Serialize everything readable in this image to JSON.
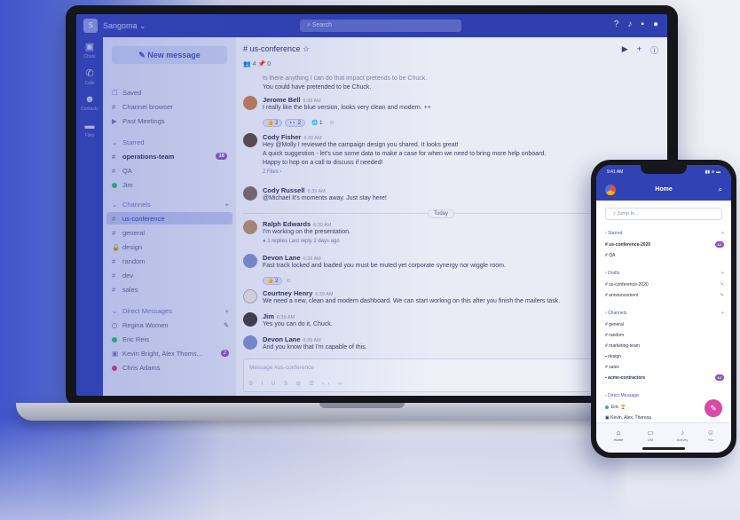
{
  "desktop": {
    "org_name": "Sangoma ⌄",
    "org_logo": "S",
    "search_placeholder": "Search",
    "rail": [
      {
        "label": "Chats",
        "icon": "chat-icon"
      },
      {
        "label": "Calls",
        "icon": "phone-icon"
      },
      {
        "label": "Contacts",
        "icon": "contacts-icon"
      },
      {
        "label": "Files",
        "icon": "folder-icon"
      }
    ],
    "sidebar": {
      "new_message": "New message",
      "top_items": [
        "Saved",
        "Channel browser",
        "Past Meetings"
      ],
      "starred_header": "Starred",
      "starred": [
        {
          "label": "operations-team",
          "badge": "16"
        },
        {
          "label": "QA",
          "badge": ""
        },
        {
          "label": "Jim",
          "badge": ""
        }
      ],
      "channels_header": "Channels",
      "channels": [
        "us-conference",
        "general",
        "design",
        "random",
        "dev",
        "sales"
      ],
      "dm_header": "Direct Messages",
      "dms": [
        {
          "label": "Regina Women",
          "badge": ""
        },
        {
          "label": "Eric Reis",
          "badge": ""
        },
        {
          "label": "Kevin Bright, Alex Thoms...",
          "badge": "2"
        },
        {
          "label": "Chris Adams",
          "badge": ""
        }
      ]
    },
    "channel": {
      "title": "# us-conference ☆",
      "members": "4",
      "pins": "0",
      "today": "Today",
      "composer_placeholder": "Message #us-conference",
      "composer_tools": "B I U S ⊟ ☰ ‹› ∞"
    },
    "messages": [
      {
        "author": "",
        "time": "",
        "lines": [
          "Is there anything I can do that impact pretends to be Chuck.",
          "You could have pretended to be Chuck."
        ]
      },
      {
        "author": "Jerome Bell",
        "time": "6:39 AM",
        "lines": [
          "I really like the blue version, looks very clean and modern. ++"
        ],
        "reactions": [
          "👍 2",
          "👀 2",
          "🌐 1"
        ]
      },
      {
        "author": "Cody Fisher",
        "time": "6:39 AM",
        "lines": [
          "Hey @Molly I reviewed the campaign design you shared. It looks great!",
          "A quick suggestion - let's use some data to make a case for when we need to bring more help onboard.",
          "Happy to hop on a call to discuss if needed!"
        ],
        "sub": "2 Files ›"
      },
      {
        "author": "Cody Russell",
        "time": "6:39 AM",
        "lines": [
          "@Michael It's moments away. Just stay here!"
        ]
      },
      {
        "author": "Ralph Edwards",
        "time": "6:39 AM",
        "lines": [
          "I'm working on the presentation."
        ],
        "sub": "1 replies  Last reply 2 days ago"
      },
      {
        "author": "Devon Lane",
        "time": "6:39 AM",
        "lines": [
          "Fast track locked and loaded you must be muted yet corporate synergy nor wiggle room."
        ],
        "reactions": [
          "👍 2"
        ]
      },
      {
        "author": "Courtney Henry",
        "time": "6:39 AM",
        "lines": [
          "We need a new, clean and modern dashboard. We can start working on this after you finish the mailers task."
        ]
      },
      {
        "author": "Jim",
        "time": "6:39 AM",
        "lines": [
          "Yes you can do it, Chuck."
        ]
      },
      {
        "author": "Devon Lane",
        "time": "6:39 AM",
        "lines": [
          "And you know that I'm capable of this."
        ]
      }
    ]
  },
  "phone": {
    "status_time": "9:41 AM",
    "status_signal": "▮▮ ≋ ▬",
    "title": "Home",
    "jump_placeholder": "Jump to...",
    "starred_header": "Starred",
    "starred": [
      {
        "label": "us-conference-2020",
        "badge": "12"
      },
      {
        "label": "QA",
        "badge": ""
      }
    ],
    "drafts_header": "Drafts",
    "drafts": [
      "us-conference-2020",
      "announcement"
    ],
    "channels_header": "Channels",
    "channels": [
      "general",
      "random",
      "marketing-team",
      "design",
      "sales",
      "acme-contractors"
    ],
    "acme_badge": "12",
    "dm_header": "Direct Message",
    "dms": [
      "Eric 🏆",
      "Kevin, Alex, Theresa"
    ],
    "tabs": [
      "Home",
      "DM",
      "Activity",
      "You"
    ]
  },
  "colors": {
    "primary": "#3142b4",
    "accent": "#8f4fc1",
    "fab": "#d84aa6"
  }
}
